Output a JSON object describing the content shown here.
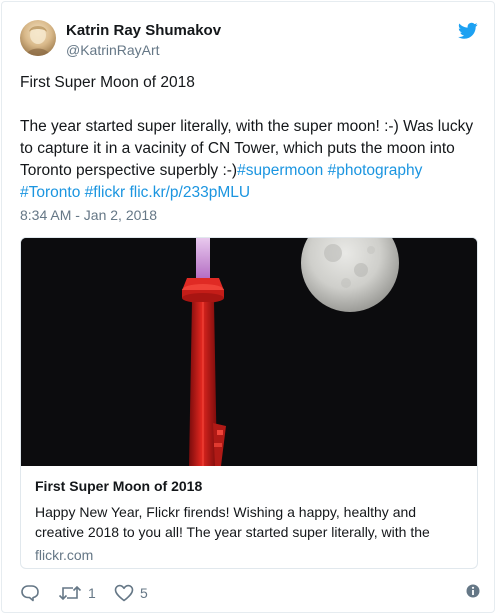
{
  "author": {
    "name": "Katrin Ray Shumakov",
    "handle": "@KatrinRayArt"
  },
  "tweet": {
    "title_line": "First Super Moon of 2018",
    "body_plain": "The year started super literally, with the super moon! :-) Was lucky to capture it in a vacinity of CN Tower, which puts the moon into Toronto perspective superbly :-)",
    "hashtags": [
      "#supermoon",
      "#photography",
      "#Toronto",
      "#flickr"
    ],
    "url": "flic.kr/p/233pMLU",
    "timestamp": "8:34 AM - Jan 2, 2018"
  },
  "card": {
    "title": "First Super Moon of 2018",
    "description": "Happy New Year, Flickr firends! Wishing a happy, healthy and creative 2018 to you all! The year started super literally, with the",
    "domain": "flickr.com"
  },
  "actions": {
    "retweet_count": "1",
    "like_count": "5"
  },
  "icons": {
    "brand": "twitter-bird-icon",
    "reply": "reply-icon",
    "retweet": "retweet-icon",
    "like": "heart-icon",
    "info": "info-icon"
  },
  "colors": {
    "link": "#1b95e0",
    "twitter_blue": "#1da1f2",
    "secondary_text": "#657786",
    "tower_red": "#d8231f",
    "tower_top": "#c98ad6"
  }
}
